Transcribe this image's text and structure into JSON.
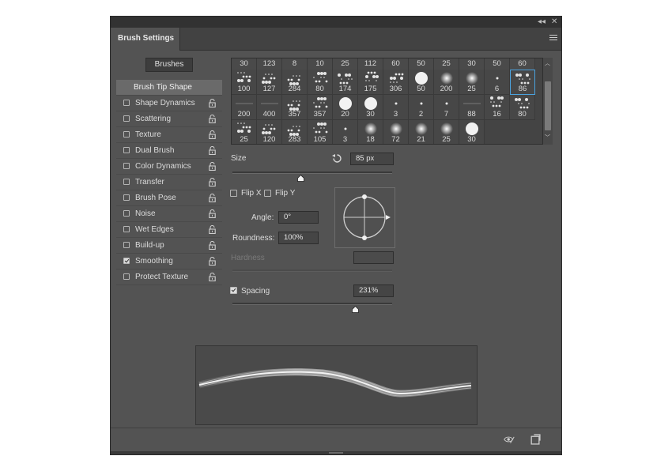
{
  "panel": {
    "title": "Brush Settings",
    "collapse_icon": "double-chevron-left-icon",
    "close_icon": "close-icon",
    "menu_icon": "panel-menu-icon"
  },
  "brushes_button": "Brushes",
  "options": [
    {
      "label": "Brush Tip Shape",
      "selected": true,
      "has_checkbox": false
    },
    {
      "label": "Shape Dynamics",
      "checked": false
    },
    {
      "label": "Scattering",
      "checked": false
    },
    {
      "label": "Texture",
      "checked": false
    },
    {
      "label": "Dual Brush",
      "checked": false
    },
    {
      "label": "Color Dynamics",
      "checked": false
    },
    {
      "label": "Transfer",
      "checked": false
    },
    {
      "label": "Brush Pose",
      "checked": false
    },
    {
      "label": "Noise",
      "checked": false
    },
    {
      "label": "Wet Edges",
      "checked": false
    },
    {
      "label": "Build-up",
      "checked": false
    },
    {
      "label": "Smoothing",
      "checked": true
    },
    {
      "label": "Protect Texture",
      "checked": false
    }
  ],
  "brush_grid": {
    "top_row_sizes": [
      "30",
      "123",
      "8",
      "10",
      "25",
      "112",
      "60",
      "50",
      "25",
      "30",
      "50",
      "60"
    ],
    "rows": [
      [
        "100",
        "127",
        "284",
        "80",
        "174",
        "175",
        "306",
        "50",
        "200",
        "25",
        "6",
        "86"
      ],
      [
        "200",
        "400",
        "357",
        "357",
        "20",
        "30",
        "3",
        "2",
        "7",
        "88",
        "16",
        "80"
      ],
      [
        "25",
        "120",
        "283",
        "105",
        "3",
        "18",
        "72",
        "21",
        "25",
        "30"
      ]
    ],
    "selected": "86"
  },
  "size": {
    "label": "Size",
    "value": "85 px",
    "reset_icon": "reset-size-icon",
    "slider_fraction": 0.43
  },
  "flip_x": {
    "label": "Flip X",
    "checked": false
  },
  "flip_y": {
    "label": "Flip Y",
    "checked": false
  },
  "angle": {
    "label": "Angle:",
    "value": "0°"
  },
  "roundness": {
    "label": "Roundness:",
    "value": "100%"
  },
  "hardness": {
    "label": "Hardness",
    "value": "",
    "disabled": true
  },
  "spacing": {
    "label": "Spacing",
    "checked": true,
    "value": "231%",
    "slider_fraction": 0.77
  },
  "footer": {
    "eye_icon": "toggle-preview-icon",
    "new_icon": "create-new-brush-icon"
  }
}
